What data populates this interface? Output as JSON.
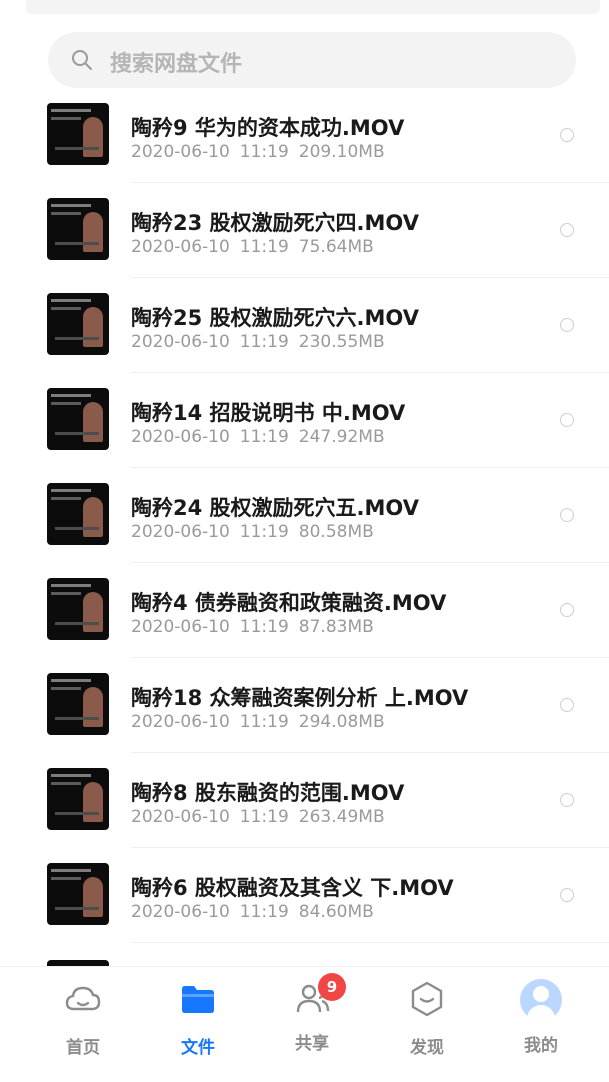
{
  "search": {
    "placeholder": "搜索网盘文件",
    "icon": "search-icon"
  },
  "files": [
    {
      "name": "陶矜9 华为的资本成功.MOV",
      "date": "2020-06-10",
      "time": "11:19",
      "size": "209.10MB"
    },
    {
      "name": "陶矜23 股权激励死穴四.MOV",
      "date": "2020-06-10",
      "time": "11:19",
      "size": "75.64MB"
    },
    {
      "name": "陶矜25 股权激励死穴六.MOV",
      "date": "2020-06-10",
      "time": "11:19",
      "size": "230.55MB"
    },
    {
      "name": "陶矜14 招股说明书 中.MOV",
      "date": "2020-06-10",
      "time": "11:19",
      "size": "247.92MB"
    },
    {
      "name": "陶矜24 股权激励死穴五.MOV",
      "date": "2020-06-10",
      "time": "11:19",
      "size": "80.58MB"
    },
    {
      "name": "陶矜4 债券融资和政策融资.MOV",
      "date": "2020-06-10",
      "time": "11:19",
      "size": "87.83MB"
    },
    {
      "name": "陶矜18 众筹融资案例分析 上.MOV",
      "date": "2020-06-10",
      "time": "11:19",
      "size": "294.08MB"
    },
    {
      "name": "陶矜8 股东融资的范围.MOV",
      "date": "2020-06-10",
      "time": "11:19",
      "size": "263.49MB"
    },
    {
      "name": "陶矜6 股权融资及其含义 下.MOV",
      "date": "2020-06-10",
      "time": "11:19",
      "size": "84.60MB"
    }
  ],
  "tabs": [
    {
      "label": "首页",
      "icon": "cloud-icon"
    },
    {
      "label": "文件",
      "icon": "folder-icon"
    },
    {
      "label": "共享",
      "icon": "users-icon",
      "badge": "9"
    },
    {
      "label": "发现",
      "icon": "discover-icon"
    },
    {
      "label": "我的",
      "icon": "avatar-icon"
    }
  ],
  "colors": {
    "accent": "#1677ff",
    "badge": "#f04646",
    "inactive": "#8c8c8c"
  }
}
